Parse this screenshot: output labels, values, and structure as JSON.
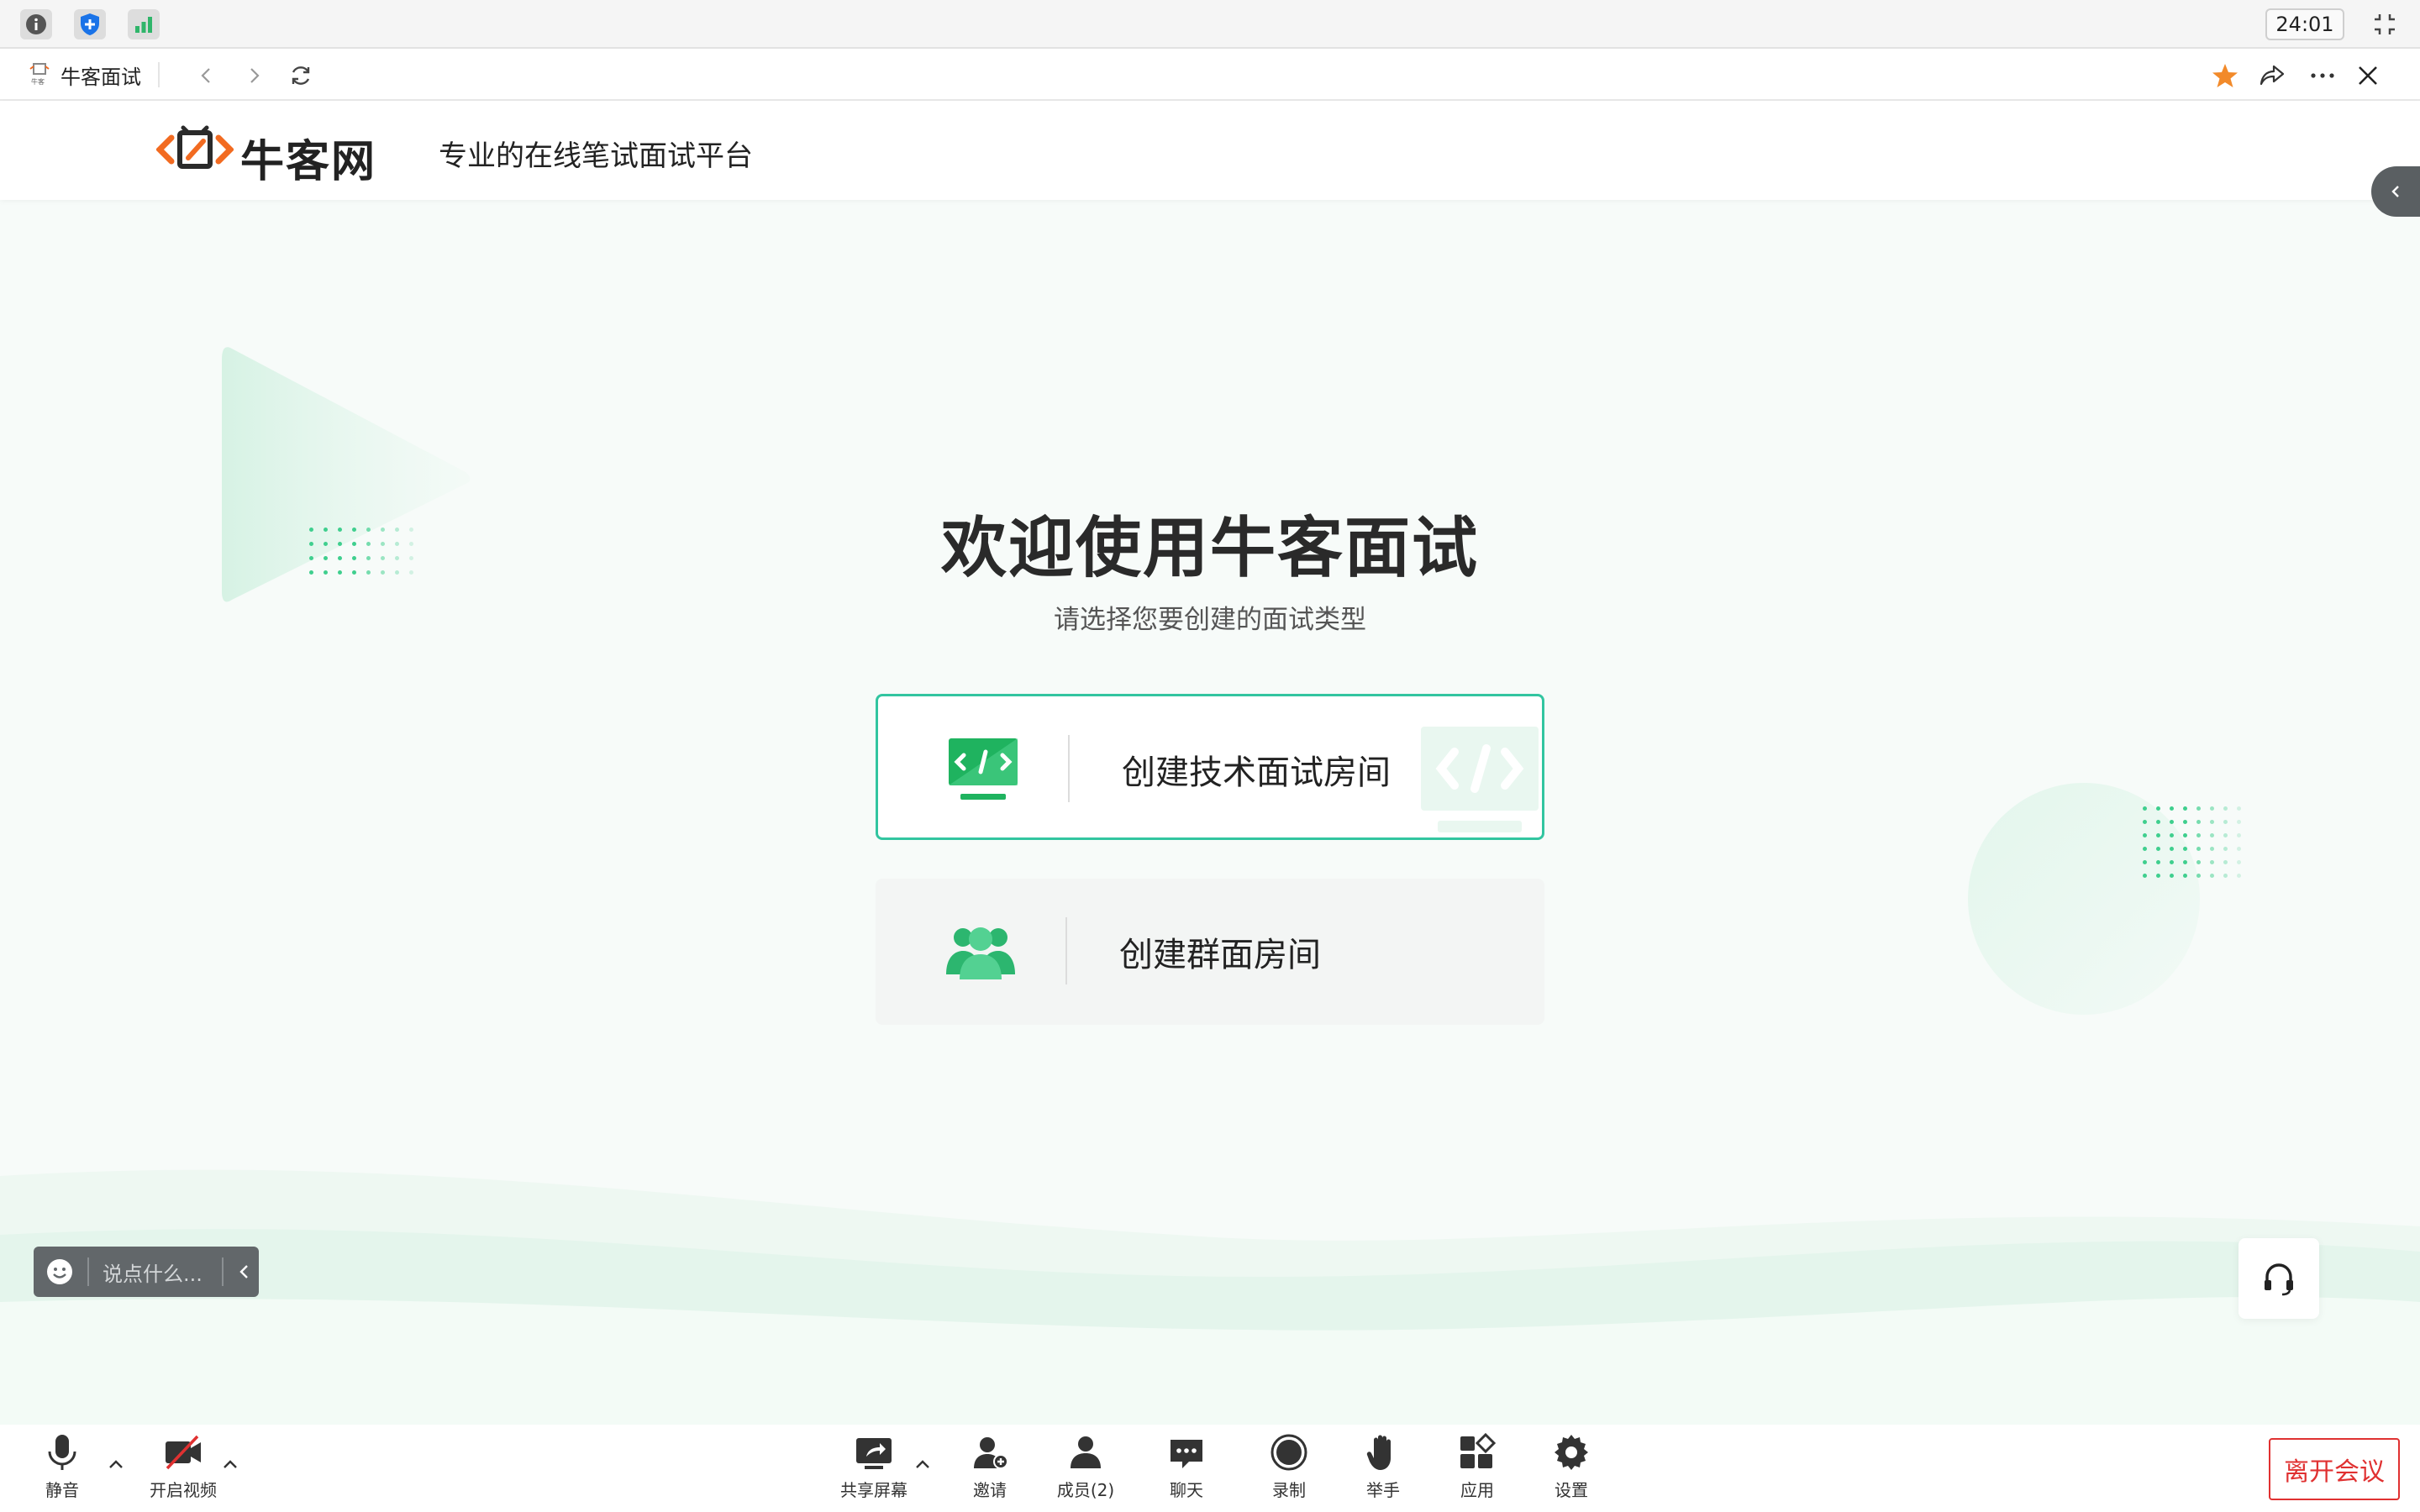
{
  "statusbar": {
    "clock": "24:01",
    "icons": [
      "info-icon",
      "shield-icon",
      "signal-bars-icon"
    ],
    "colors": {
      "shield": "#1a73e8",
      "signal": "#2fb56a"
    }
  },
  "tab": {
    "title": "牛客面试"
  },
  "header": {
    "logo_text": "牛客网",
    "slogan": "专业的在线笔试面试平台",
    "brand_color": "#f26b21"
  },
  "main": {
    "title": "欢迎使用牛客面试",
    "subtitle": "请选择您要创建的面试类型",
    "cards": [
      {
        "label": "创建技术面试房间",
        "icon": "code-monitor-icon"
      },
      {
        "label": "创建群面房间",
        "icon": "group-users-icon"
      }
    ],
    "accent": "#32c5a0"
  },
  "chat": {
    "placeholder": "说点什么..."
  },
  "toolbar": {
    "mute": "静音",
    "video": "开启视频",
    "share": "共享屏幕",
    "invite": "邀请",
    "members": "成员(2)",
    "chat": "聊天",
    "record": "录制",
    "raise_hand": "举手",
    "apps": "应用",
    "settings": "设置",
    "leave": "离开会议",
    "leave_color": "#e03131"
  }
}
